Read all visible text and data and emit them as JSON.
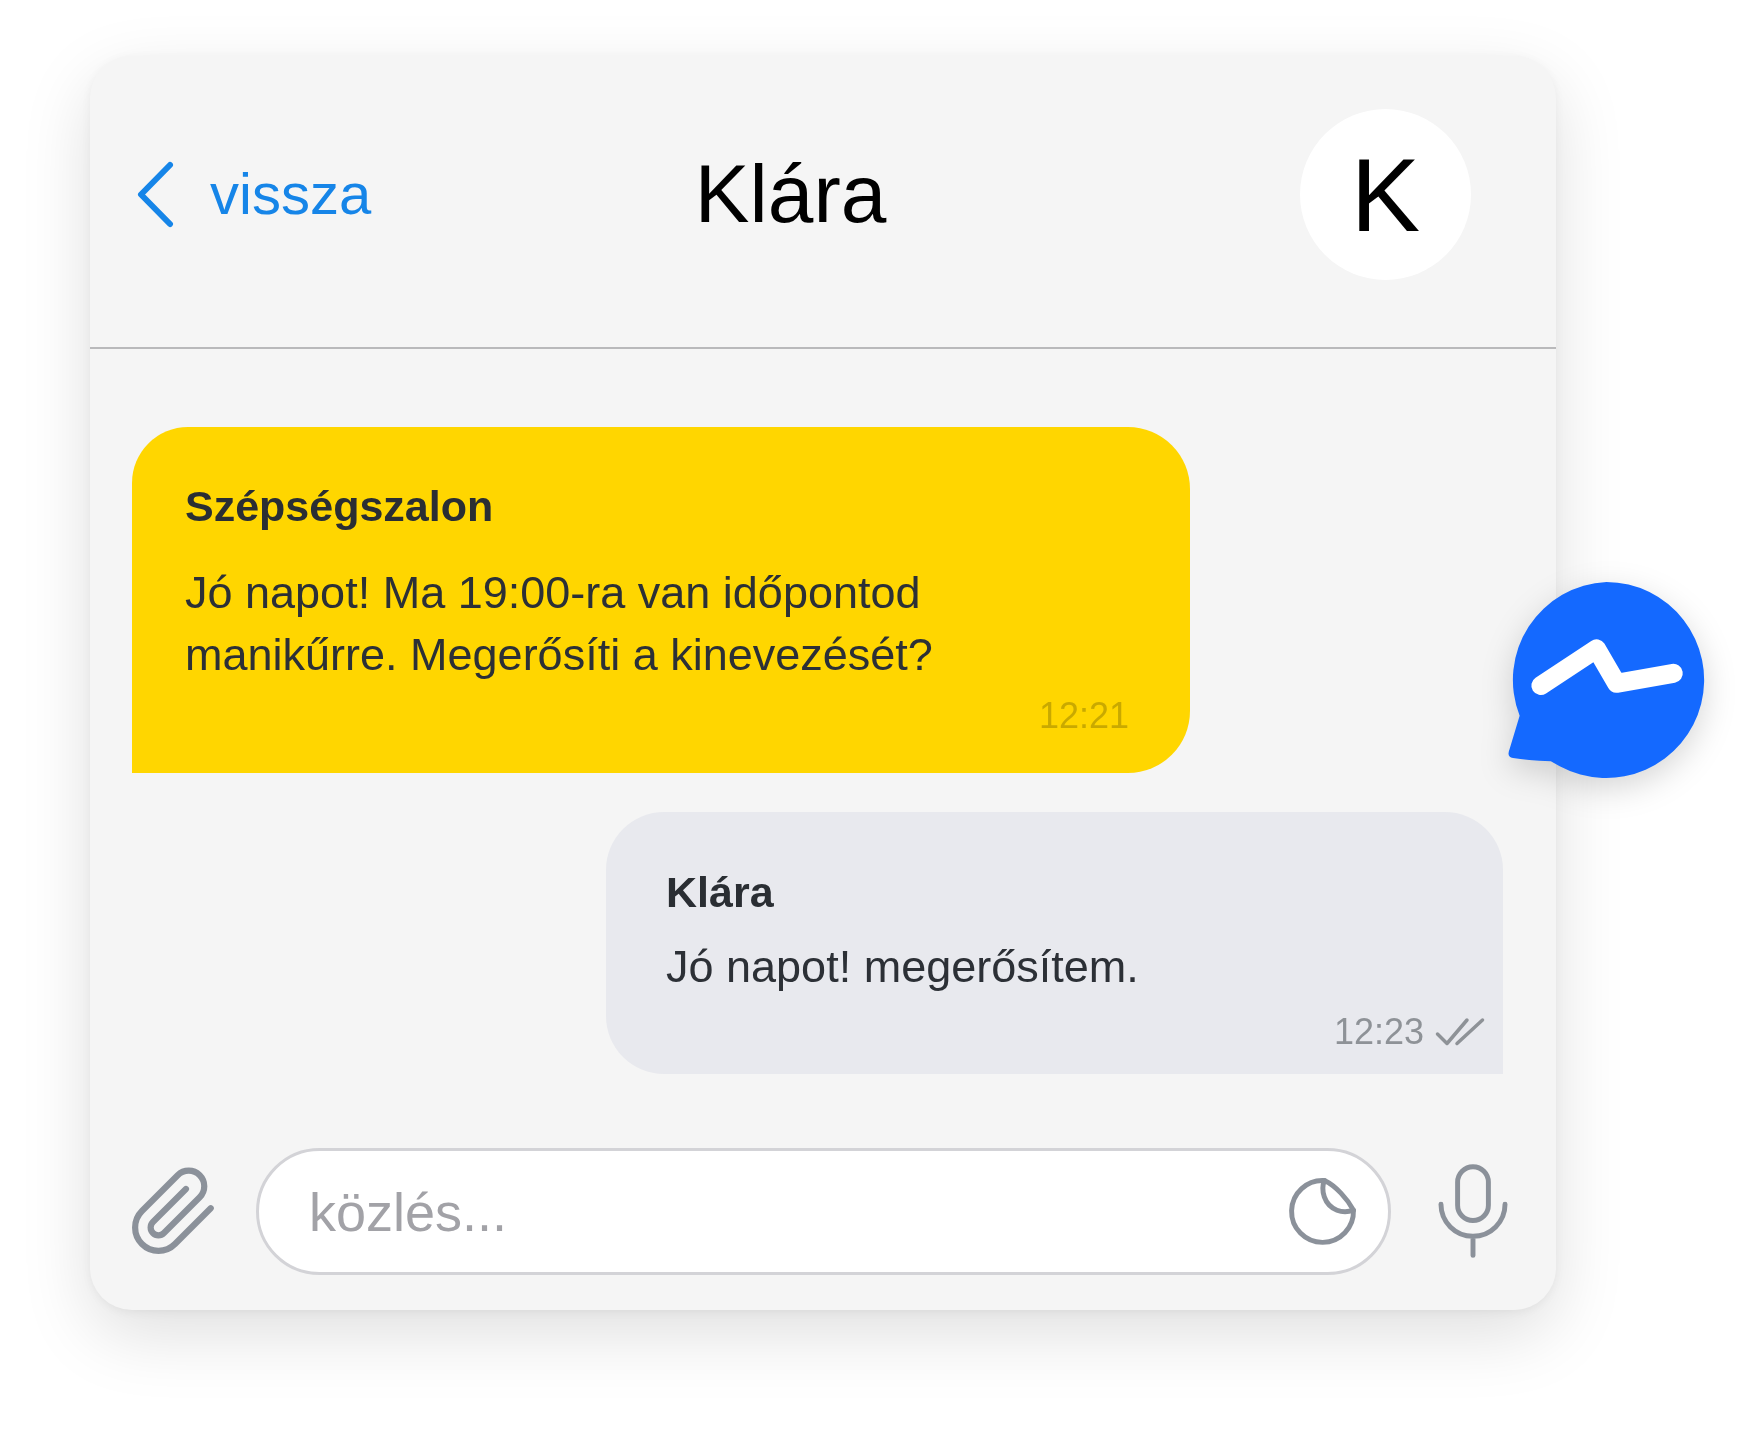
{
  "header": {
    "back_label": "vissza",
    "title": "Klára",
    "avatar_initial": "K"
  },
  "messages": [
    {
      "kind": "incoming",
      "sender": "Szépségszalon",
      "text": "Jó napot! Ma 19:00-ra van időpontod manikűrre. Megerősíti a kinevezését?",
      "time": "12:21"
    },
    {
      "kind": "outgoing",
      "sender": "Klára",
      "text": "Jó napot! megerősítem.",
      "time": "12:23",
      "read": true
    }
  ],
  "composer": {
    "placeholder": "közlés..."
  }
}
